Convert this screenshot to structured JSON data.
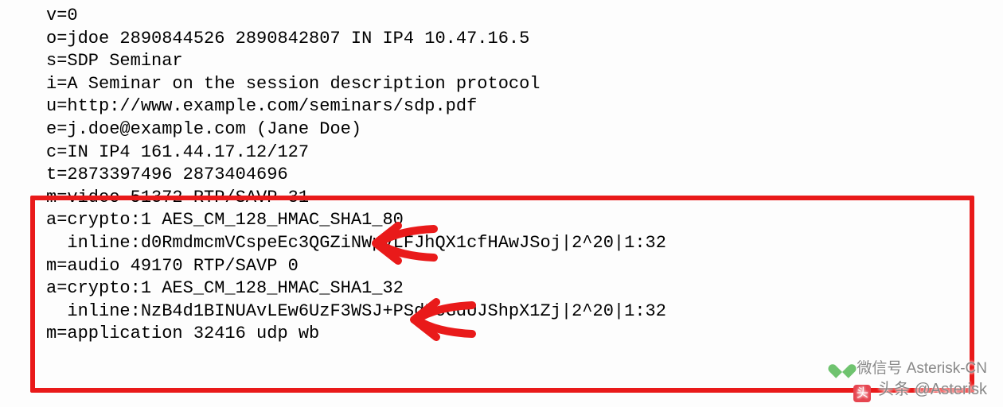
{
  "sdp": {
    "l0": "v=0",
    "l1": "o=jdoe 2890844526 2890842807 IN IP4 10.47.16.5",
    "l2": "s=SDP Seminar",
    "l3": "i=A Seminar on the session description protocol",
    "l4": "u=http://www.example.com/seminars/sdp.pdf",
    "l5": "e=j.doe@example.com (Jane Doe)",
    "l6": "c=IN IP4 161.44.17.12/127",
    "l7": "t=2873397496 2873404696",
    "l8": "m=video 51372 RTP/SAVP 31",
    "l9": "a=crypto:1 AES_CM_128_HMAC_SHA1_80",
    "l10": "  inline:d0RmdmcmVCspeEc3QGZiNWpVLFJhQX1cfHAwJSoj|2^20|1:32",
    "l11": "m=audio 49170 RTP/SAVP 0",
    "l12": "a=crypto:1 AES_CM_128_HMAC_SHA1_32",
    "l13": "  inline:NzB4d1BINUAvLEw6UzF3WSJ+PSdFcGdUJShpX1Zj|2^20|1:32",
    "l14": "m=application 32416 udp wb"
  },
  "watermark": {
    "line1a": "微信号",
    "line1b": "Asterisk-CN",
    "line2a": "头条",
    "line2b": "@Asterisk"
  }
}
